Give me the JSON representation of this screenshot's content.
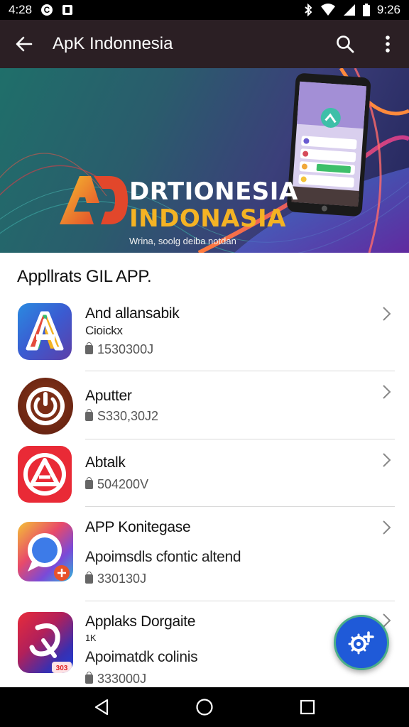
{
  "status_bar": {
    "time_left": "4:28",
    "time_right": "9:26",
    "icons": [
      "c-circle-icon",
      "notification-icon",
      "bluetooth-icon",
      "wifi-icon",
      "signal-icon",
      "battery-icon"
    ]
  },
  "app_bar": {
    "title": "ApK Indonnesia",
    "icons": [
      "back-arrow-icon",
      "search-icon",
      "more-vert-icon"
    ]
  },
  "banner": {
    "logo_text": "AD",
    "line1": "DRTIONESIA",
    "line2": "INDONASIA",
    "tagline": "Wrina, soolg deiba notdan"
  },
  "section": {
    "title": "Appllrats GIL APP."
  },
  "apps": [
    {
      "name": "And allansabik",
      "subtitle": "Cioickx",
      "meta": "1530300J",
      "icon": "play-store-a-icon"
    },
    {
      "name": "Aputter",
      "subtitle": "",
      "meta": "S330,30J2",
      "icon": "power-icon"
    },
    {
      "name": "Abtalk",
      "subtitle": "",
      "meta": "504200V",
      "icon": "triangle-logo-icon"
    },
    {
      "name": "APP Konitegase",
      "subtitle": "Apoimsdls cfontic altend",
      "meta": "330130J",
      "icon": "chat-search-icon"
    },
    {
      "name": "Applaks Dorgaite",
      "subtitle": "Apoimatdk colinis",
      "small_line": "1K",
      "meta": "333000J",
      "icon": "swirl-logo-icon"
    }
  ],
  "colors": {
    "app_bar": "#2b1f24",
    "accent_yellow": "#f4b324",
    "fab": "#1f5ad8"
  },
  "nav": {
    "icons": [
      "back-triangle-icon",
      "home-circle-icon",
      "recents-square-icon"
    ]
  }
}
